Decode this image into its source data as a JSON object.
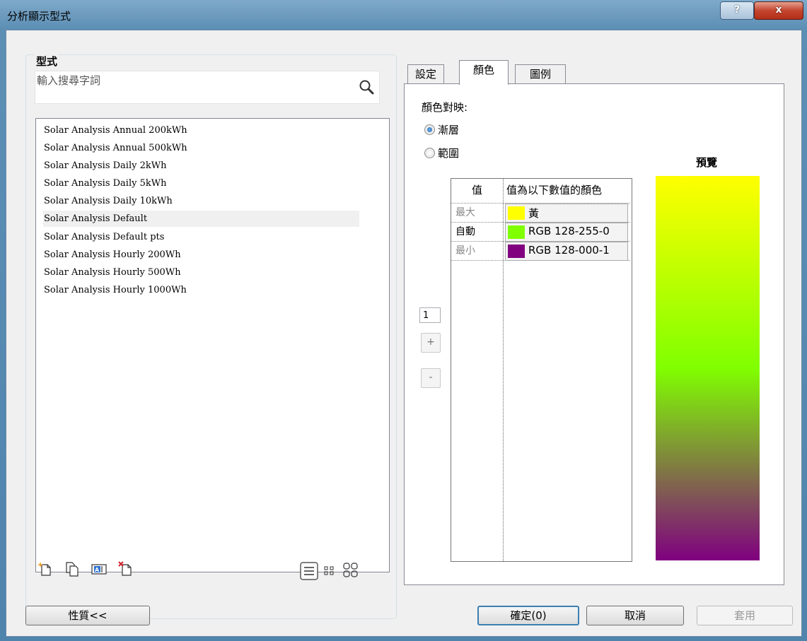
{
  "window": {
    "title": "分析顯示型式",
    "help_label": "?",
    "close_label": "x"
  },
  "styles_panel": {
    "group_label": "型式",
    "search_placeholder": "輸入搜尋字詞",
    "items": [
      "Solar Analysis Annual 200kWh",
      "Solar Analysis Annual 500kWh",
      "Solar Analysis Daily 2kWh",
      "Solar Analysis Daily 5kWh",
      "Solar Analysis Daily 10kWh",
      "Solar Analysis Default",
      "Solar Analysis Default pts",
      "Solar Analysis Hourly 200Wh",
      "Solar Analysis Hourly 500Wh",
      "Solar Analysis Hourly 1000Wh"
    ],
    "selected_item": "Solar Analysis Default"
  },
  "tabs": [
    {
      "label": "設定",
      "active": false
    },
    {
      "label": "顏色",
      "active": true
    },
    {
      "label": "圖例",
      "active": false
    }
  ],
  "color_tab": {
    "mapping_label": "顏色對映:",
    "options": [
      {
        "label": "漸層",
        "checked": true
      },
      {
        "label": "範圍",
        "checked": false
      }
    ],
    "table": {
      "headers": [
        "值",
        "值為以下數值的顏色"
      ],
      "rows": [
        {
          "value": "最大",
          "muted": true,
          "color_text": "黃",
          "color_hex": "#ffff00"
        },
        {
          "value": "自動",
          "muted": false,
          "color_text": "RGB 128-255-0",
          "color_hex": "#80ff00"
        },
        {
          "value": "最小",
          "muted": true,
          "color_text": "RGB 128-000-1",
          "color_hex": "#800080"
        }
      ]
    },
    "stepper_value": "1",
    "add_label": "+",
    "remove_label": "-",
    "preview_label": "預覽",
    "preview_colors": [
      "#ffff00",
      "#80ff00",
      "#800080"
    ]
  },
  "buttons": {
    "properties": "性質<<",
    "ok": "確定(0)",
    "cancel": "取消",
    "apply": "套用"
  }
}
